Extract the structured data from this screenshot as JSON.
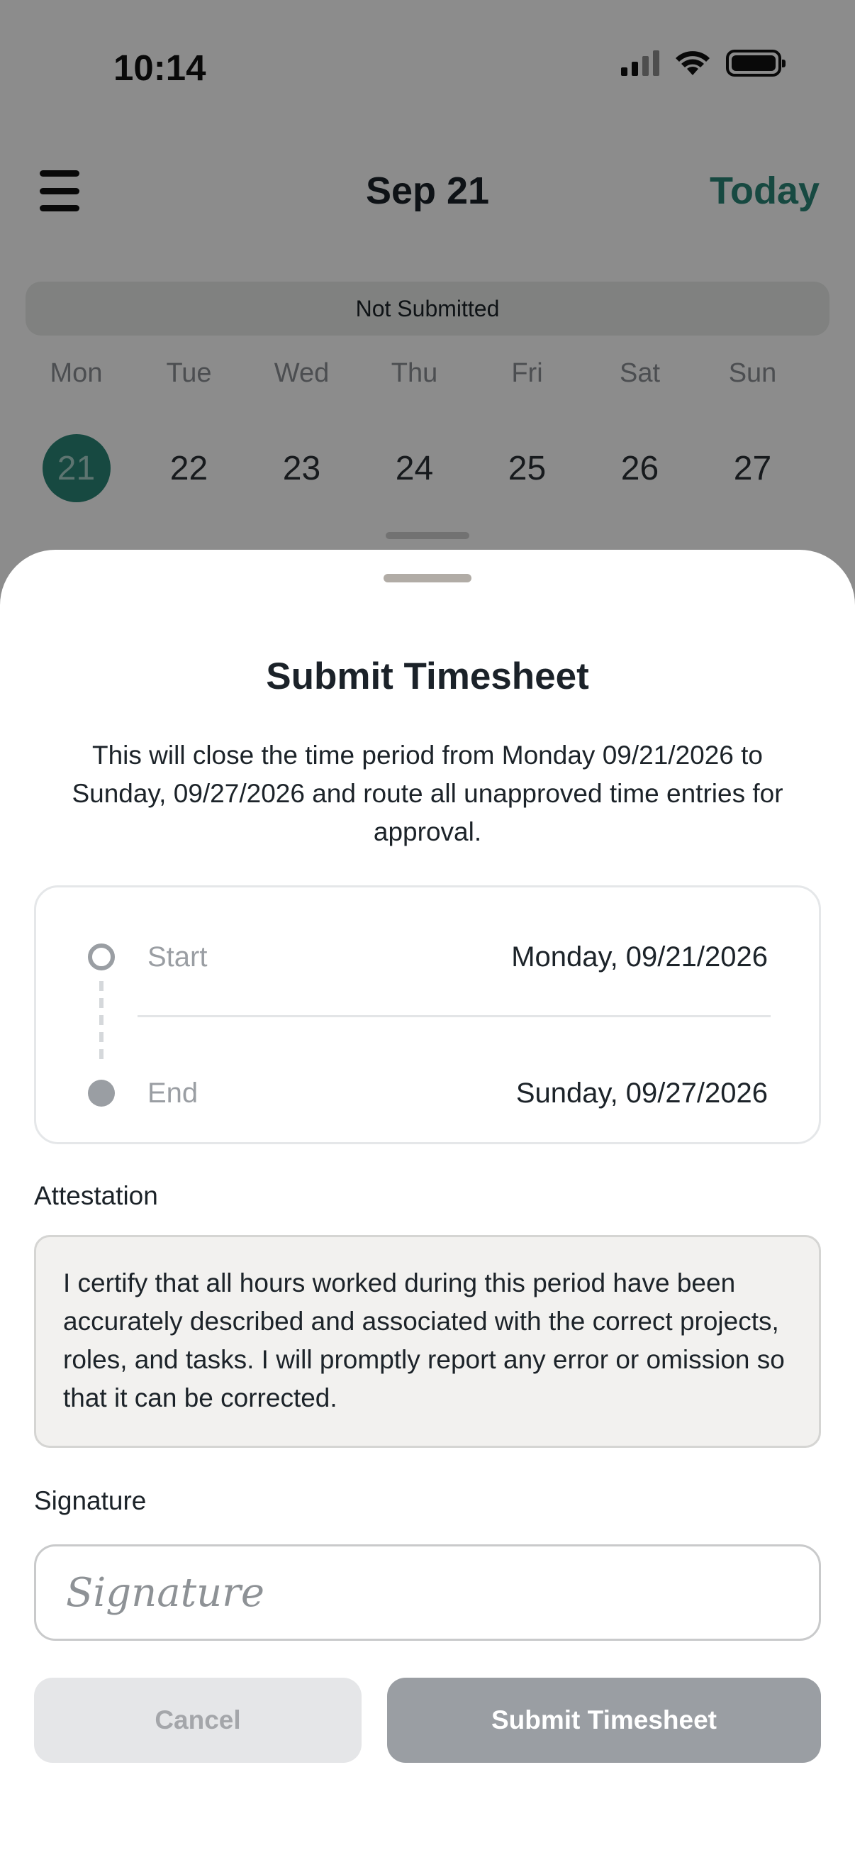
{
  "status_bar": {
    "time": "10:14",
    "icons": [
      "cellular-signal-icon",
      "wifi-icon",
      "battery-icon"
    ]
  },
  "header": {
    "menu_icon": "hamburger-menu-icon",
    "title": "Sep 21",
    "today_label": "Today"
  },
  "week": {
    "status": "Not Submitted",
    "days": [
      "Mon",
      "Tue",
      "Wed",
      "Thu",
      "Fri",
      "Sat",
      "Sun"
    ],
    "dates": [
      "21",
      "22",
      "23",
      "24",
      "25",
      "26",
      "27"
    ],
    "selected_date": "21"
  },
  "sheet": {
    "title": "Submit Timesheet",
    "description": "This will close the time period from Monday 09/21/2026 to Sunday, 09/27/2026 and route all unapproved time entries for approval.",
    "range": {
      "start_label": "Start",
      "start_value": "Monday, 09/21/2026",
      "end_label": "End",
      "end_value": "Sunday, 09/27/2026"
    },
    "attestation_label": "Attestation",
    "attestation_text": "I certify that all hours worked during this period have been accurately described and associated with the correct projects, roles, and tasks. I will promptly report any error or omission so that it can be corrected.",
    "signature_label": "Signature",
    "signature_placeholder": "Signature",
    "cancel_label": "Cancel",
    "submit_label": "Submit Timesheet"
  },
  "colors": {
    "accent": "#2a8577",
    "disabled_button": "#9a9ea3",
    "cancel_button": "#e5e6e8"
  }
}
